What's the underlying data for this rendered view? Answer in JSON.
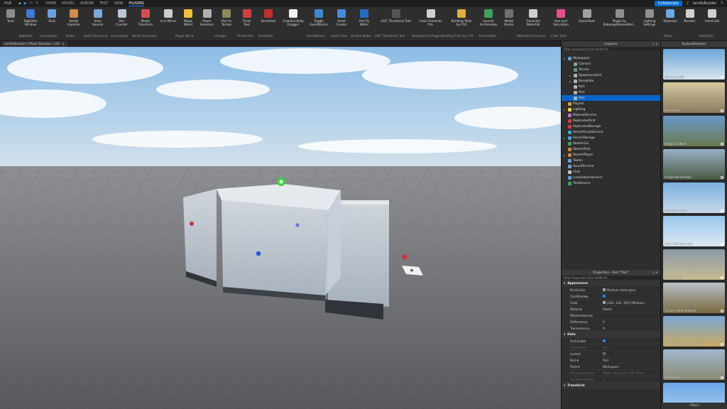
{
  "titlebar": {
    "file": "FILE",
    "menu": [
      "HOME",
      "MODEL",
      "AVATAR",
      "TEST",
      "VIEW",
      "PLUGINS"
    ],
    "active_menu": "PLUGINS",
    "collaborate": "Collaborate",
    "user": "IamRoBuilder"
  },
  "ribbon": {
    "tools": [
      {
        "label": "Tools",
        "icon": "wrench-icon",
        "color": "#8c8c8c"
      },
      {
        "label": "TagEditor\nWindow",
        "icon": "tag-icon",
        "color": "#3c7ad6"
      },
      {
        "label": "Tools",
        "icon": "tools-icon",
        "color": "#6aa0e0"
      },
      {
        "label": "Avatar\nImporter",
        "icon": "avatar-icon",
        "color": "#d08a4a"
      },
      {
        "label": "View\nSounds",
        "icon": "sound-icon",
        "color": "#7aa8d8"
      },
      {
        "label": "Part\nCounter",
        "icon": "cube-icon",
        "color": "#b9c6d6"
      },
      {
        "label": "Model\nTransform",
        "icon": "transform-icon",
        "color": "#d05050"
      },
      {
        "label": "Line Mirror",
        "icon": "mirror-icon",
        "color": "#cccccc"
      },
      {
        "label": "Magic\nWand",
        "icon": "wand-icon",
        "color": "#f0c040"
      },
      {
        "label": "Power\nSelectors",
        "icon": "selector-icon",
        "color": "#b0b0b0"
      },
      {
        "label": "Part to\nTerrain",
        "icon": "terrain-icon",
        "color": "#8a8a5a"
      },
      {
        "label": "Three\nText",
        "icon": "text-icon",
        "color": "#d04040"
      },
      {
        "label": "Brushtool",
        "icon": "brush-icon",
        "color": "#c03030"
      },
      {
        "label": "Celestial Body\nDragger",
        "icon": "sun-icon",
        "color": "#f0f0f0"
      },
      {
        "label": "Toggle\nEventBlocks",
        "icon": "toggle-icon",
        "color": "#3a8ad0"
      },
      {
        "label": "Asset\nCreator",
        "icon": "asset-icon",
        "color": "#4a8ad8"
      },
      {
        "label": "Part To\nWater",
        "icon": "water-icon",
        "color": "#2a6ac0"
      },
      {
        "label": "UGC Thumbnail Tool",
        "icon": "thumbnail-icon",
        "color": "#555555"
      },
      {
        "label": "Load Character\nPro",
        "icon": "character-icon",
        "color": "#d0d0d0"
      },
      {
        "label": "Building Tools\nby F3X",
        "icon": "f3x-icon",
        "color": "#e0b040"
      },
      {
        "label": "Launch\nArchimedes",
        "icon": "archimedes-icon",
        "color": "#40a060"
      },
      {
        "label": "Model\nResize",
        "icon": "resize-icon",
        "color": "#707070"
      },
      {
        "label": "Generate\nWaterfall",
        "icon": "waterfall-icon",
        "color": "#d0d0d0"
      },
      {
        "label": "Hue and\nSaturation",
        "icon": "hue-icon",
        "color": "#e05090"
      },
      {
        "label": "GeomTools",
        "icon": "geom-icon",
        "color": "#a0a0a0"
      },
      {
        "label": "Plugin by\nRoboxi@RoboxiaRet...",
        "icon": "plugin-icon",
        "color": "#909090"
      },
      {
        "label": "Lighting\nSettings",
        "icon": "lighting-icon",
        "color": "#909090"
      },
      {
        "label": "Skyboxes",
        "icon": "cloud-icon",
        "color": "#6aa8e8"
      },
      {
        "label": "Beveler",
        "icon": "bevel-icon",
        "color": "#d0d0d0"
      },
      {
        "label": "AutoCode",
        "icon": "code-icon",
        "color": "#d0d0d0"
      }
    ],
    "groups": [
      "TagEditor",
      "Localization",
      "Avatar",
      "Audio Discovery",
      "Gameassist",
      "Model Geometry",
      "Magic Wand",
      "mkutgui",
      "Threed Part",
      "Brushtool",
      "EventBlocks",
      "Asset Tools",
      "Outline Water",
      "UGC Thumbnail Tool",
      "AlreadyPro's Plugins",
      "Building Tools by F3X",
      "Archimedes",
      "Waterfall Generator",
      "Color Tools",
      "Relics",
      "Roblox[3]"
    ]
  },
  "tab": {
    "label": "IamRoBuilder's Place Number: 124",
    "close": "×"
  },
  "explorer": {
    "title": "Explorer",
    "filter": "Filter workspace (Ctrl+Shift+X)",
    "items": [
      {
        "label": "Workspace",
        "depth": 0,
        "arrow": "▾",
        "color": "#5aa0e0"
      },
      {
        "label": "Camera",
        "depth": 1,
        "arrow": "",
        "color": "#8a9ab0"
      },
      {
        "label": "Terrain",
        "depth": 1,
        "arrow": "",
        "color": "#6a9a6a"
      },
      {
        "label": "SpawnLocation",
        "depth": 1,
        "arrow": "▸",
        "color": "#b0b0b0"
      },
      {
        "label": "Baseplate",
        "depth": 1,
        "arrow": "▸",
        "color": "#b0b0b0"
      },
      {
        "label": "Part",
        "depth": 1,
        "arrow": "",
        "color": "#b0b0b0"
      },
      {
        "label": "Part",
        "depth": 1,
        "arrow": "",
        "color": "#b0b0b0"
      },
      {
        "label": "Part",
        "depth": 1,
        "arrow": "",
        "color": "#b0b0b0"
      },
      {
        "label": "Players",
        "depth": 0,
        "arrow": "",
        "color": "#d0a040"
      },
      {
        "label": "Lighting",
        "depth": 0,
        "arrow": "▸",
        "color": "#f0d040"
      },
      {
        "label": "MaterialService",
        "depth": 0,
        "arrow": "",
        "color": "#c070c0"
      },
      {
        "label": "ReplicatedFirst",
        "depth": 0,
        "arrow": "",
        "color": "#d04040"
      },
      {
        "label": "ReplicatedStorage",
        "depth": 0,
        "arrow": "",
        "color": "#d04040"
      },
      {
        "label": "ServerScriptService",
        "depth": 0,
        "arrow": "",
        "color": "#40a0d0"
      },
      {
        "label": "ServerStorage",
        "depth": 0,
        "arrow": "▸",
        "color": "#40a0d0"
      },
      {
        "label": "StarterGui",
        "depth": 0,
        "arrow": "",
        "color": "#40a060"
      },
      {
        "label": "StarterPack",
        "depth": 0,
        "arrow": "",
        "color": "#d08040"
      },
      {
        "label": "StarterPlayer",
        "depth": 0,
        "arrow": "▸",
        "color": "#d08040"
      },
      {
        "label": "Teams",
        "depth": 0,
        "arrow": "",
        "color": "#60a0d0"
      },
      {
        "label": "SoundService",
        "depth": 0,
        "arrow": "",
        "color": "#7a9ad0"
      },
      {
        "label": "Chat",
        "depth": 0,
        "arrow": "",
        "color": "#c0c0c0"
      },
      {
        "label": "LocalizationService",
        "depth": 0,
        "arrow": "",
        "color": "#60a0d0"
      },
      {
        "label": "TestService",
        "depth": 0,
        "arrow": "",
        "color": "#40a060"
      }
    ],
    "selected_index": 7
  },
  "properties": {
    "title": "Properties - Part \"Part\"",
    "filter": "Filter Properties (Ctrl+Shift+P)",
    "sections": [
      {
        "name": "Appearance",
        "rows": [
          {
            "k": "BrickColor",
            "v": "Medium stone grey",
            "swatch": "#a3a2a5"
          },
          {
            "k": "CastShadow",
            "v": "",
            "check": true
          },
          {
            "k": "Color",
            "v": "[163, 162, 165] [Medium...",
            "swatch": "#a3a2a5"
          },
          {
            "k": "Material",
            "v": "Plastic"
          },
          {
            "k": "MaterialVariant",
            "v": ""
          },
          {
            "k": "Reflectance",
            "v": "0"
          },
          {
            "k": "Transparency",
            "v": "0"
          }
        ]
      },
      {
        "name": "Data",
        "rows": [
          {
            "k": "Archivable",
            "v": "",
            "check": true
          },
          {
            "k": "ClassName",
            "v": "Part",
            "dim": true
          },
          {
            "k": "Locked",
            "v": "",
            "check": false
          },
          {
            "k": "Name",
            "v": "Part"
          },
          {
            "k": "Parent",
            "v": "Workspace"
          },
          {
            "k": "ResizeableFaces",
            "v": "Right, Top, Back, Left, Botto...",
            "dim": true
          },
          {
            "k": "ResizeIncrement",
            "v": "1",
            "dim": true
          }
        ]
      },
      {
        "name": "Transform",
        "rows": []
      }
    ]
  },
  "skybox": {
    "title": "SkyboxBrowser",
    "items": [
      {
        "name": "Afternoon Sky",
        "c1": "#6aa6d8",
        "c2": "#d8e4ee"
      },
      {
        "name": "Bella Dune",
        "c1": "#d6c9a0",
        "c2": "#8a7a60"
      },
      {
        "name": "Bridge Cividale",
        "c1": "#6a98c8",
        "c2": "#6a7a50"
      },
      {
        "name": "Bridge Montenegro",
        "c1": "#98b0c8",
        "c2": "#4a5a40"
      },
      {
        "name": "Canadian Coast",
        "c1": "#7ab0e0",
        "c2": "#c8d8e8"
      },
      {
        "name": "Clear Afternoon Sky",
        "c1": "#9ac6ee",
        "c2": "#dce8f2"
      },
      {
        "name": "Clouded Sky",
        "c1": "#8a9aa8",
        "c2": "#c8ba90"
      },
      {
        "name": "Country Road Autumn",
        "c1": "#b8c0c8",
        "c2": "#7a6a40"
      },
      {
        "name": "Cumulus Fractus Afternoon",
        "c1": "#7aa8d8",
        "c2": "#c8a860"
      },
      {
        "name": "D336 Road",
        "c1": "#a0b8d0",
        "c2": "#8a8a70"
      },
      {
        "name": "",
        "c1": "#6aa6e8",
        "c2": "#a8ccee"
      }
    ],
    "filters": "Filters"
  }
}
